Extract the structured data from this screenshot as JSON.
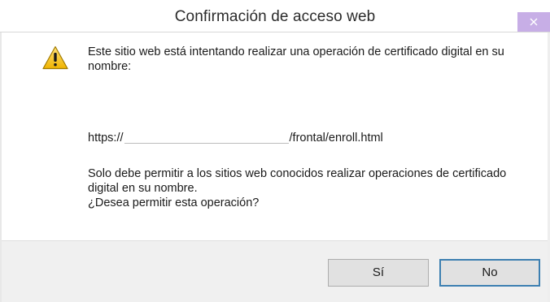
{
  "window": {
    "title": "Confirmación de acceso web"
  },
  "icons": {
    "close": "close-icon",
    "warning": "warning-icon"
  },
  "message": {
    "intro": "Este sitio web está intentando realizar una operación de certificado digital en su nombre:",
    "url_prefix": "https://",
    "url_suffix": "/frontal/enroll.html",
    "advice": "Solo debe permitir a los sitios web conocidos realizar operaciones de certificado digital en su nombre.",
    "question": "¿Desea permitir esta operación?"
  },
  "buttons": {
    "yes_label": "Sí",
    "no_label": "No"
  },
  "colors": {
    "close_button": "#c7aee6",
    "warning_yellow": "#f4c430",
    "focus_border": "#3c7fb1"
  }
}
